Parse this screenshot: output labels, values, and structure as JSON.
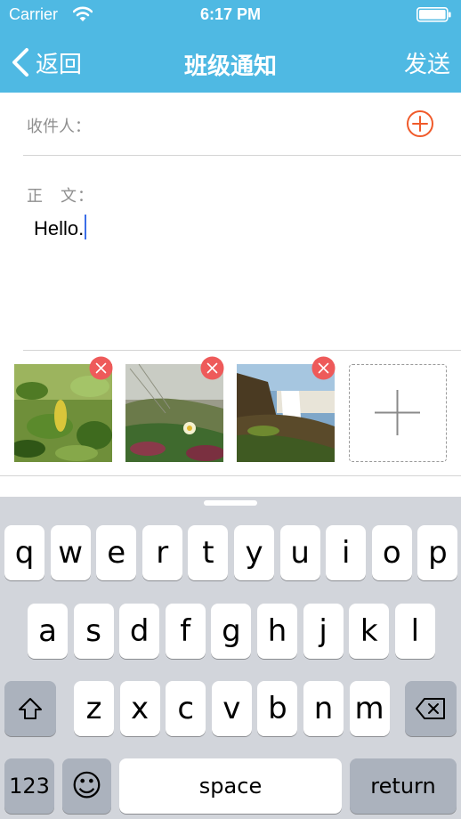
{
  "status": {
    "carrier": "Carrier",
    "time": "6:17 PM"
  },
  "nav": {
    "back_label": "返回",
    "title": "班级通知",
    "send_label": "发送"
  },
  "form": {
    "recipient_label": "收件人：",
    "body_label": "正　文：",
    "body_value": "Hello."
  },
  "photos": [
    {
      "icon": "photo-leaves"
    },
    {
      "icon": "photo-flower"
    },
    {
      "icon": "photo-waterfall"
    }
  ],
  "colors": {
    "header": "#4fb9e3",
    "accent": "#f05a2a",
    "delete": "#ee5a5a",
    "caret": "#3b6ee8"
  },
  "keyboard": {
    "row1": [
      "q",
      "w",
      "e",
      "r",
      "t",
      "y",
      "u",
      "i",
      "o",
      "p"
    ],
    "row2": [
      "a",
      "s",
      "d",
      "f",
      "g",
      "h",
      "j",
      "k",
      "l"
    ],
    "row3": [
      "z",
      "x",
      "c",
      "v",
      "b",
      "n",
      "m"
    ],
    "numbers_label": "123",
    "space_label": "space",
    "return_label": "return",
    "emoji_label": "☺"
  }
}
